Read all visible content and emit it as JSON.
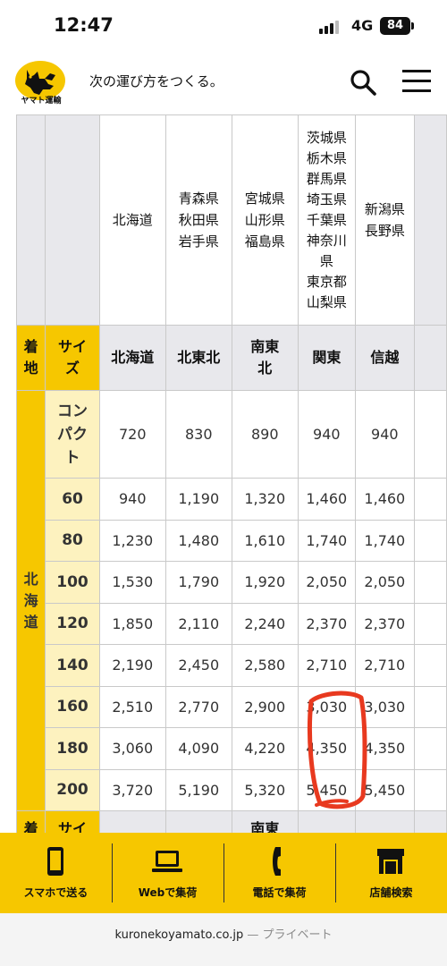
{
  "status_bar": {
    "time": "12:47",
    "network": "4G",
    "battery": "84"
  },
  "header": {
    "logo_text": "ヤマト運輸",
    "tagline": "次の運び方をつくる。"
  },
  "table": {
    "prefecture_headers": [
      "北海道",
      "青森県\n秋田県\n岩手県",
      "宮城県\n山形県\n福島県",
      "茨城県\n栃木県\n群馬県\n埼玉県\n千葉県\n神奈川\n県\n東京都\n山梨県",
      "新潟県\n長野県"
    ],
    "corner_label": "着\n地",
    "size_label": "サイ\nズ",
    "region_headers": [
      "北海道",
      "北東北",
      "南東\n北",
      "関東",
      "信越"
    ],
    "origin_label": "北\n海\n道",
    "rows": [
      {
        "size": "コン\nパク\nト",
        "values": [
          "720",
          "830",
          "890",
          "940",
          "940"
        ]
      },
      {
        "size": "60",
        "values": [
          "940",
          "1,190",
          "1,320",
          "1,460",
          "1,460"
        ]
      },
      {
        "size": "80",
        "values": [
          "1,230",
          "1,480",
          "1,610",
          "1,740",
          "1,740"
        ]
      },
      {
        "size": "100",
        "values": [
          "1,530",
          "1,790",
          "1,920",
          "2,050",
          "2,050"
        ]
      },
      {
        "size": "120",
        "values": [
          "1,850",
          "2,110",
          "2,240",
          "2,370",
          "2,370"
        ]
      },
      {
        "size": "140",
        "values": [
          "2,190",
          "2,450",
          "2,580",
          "2,710",
          "2,710"
        ]
      },
      {
        "size": "160",
        "values": [
          "2,510",
          "2,770",
          "2,900",
          "3,030",
          "3,030"
        ]
      },
      {
        "size": "180",
        "values": [
          "3,060",
          "4,090",
          "4,220",
          "4,350",
          "4,350"
        ]
      },
      {
        "size": "200",
        "values": [
          "3,720",
          "5,190",
          "5,320",
          "5,450",
          "5,450"
        ]
      }
    ],
    "next_row": {
      "left": "着",
      "size": "サイ",
      "region": "南東"
    }
  },
  "bottom_nav": [
    {
      "label": "スマホで送る",
      "icon": "smartphone-icon"
    },
    {
      "label": "Webで集荷",
      "icon": "laptop-icon"
    },
    {
      "label": "電話で集荷",
      "icon": "phone-icon"
    },
    {
      "label": "店舗検索",
      "icon": "store-icon"
    }
  ],
  "url_bar": {
    "domain": "kuronekoyamato.co.jp",
    "separator": "—",
    "mode": "プライベート"
  },
  "colors": {
    "brand_yellow": "#f6c700",
    "size_cell": "#fdf2bf",
    "header_gray": "#e8e8ec",
    "highlight_red": "#e8391f"
  }
}
